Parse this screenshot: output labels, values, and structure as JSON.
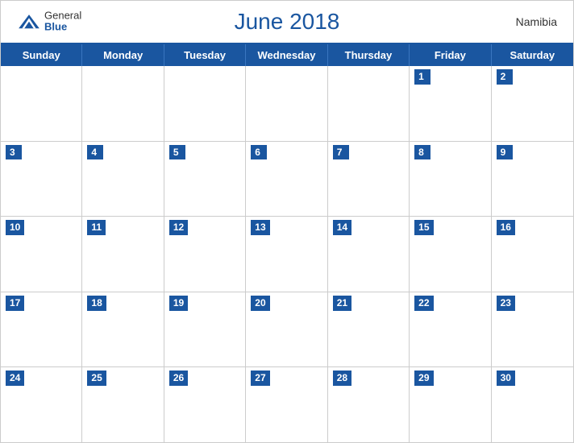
{
  "header": {
    "title": "June 2018",
    "country": "Namibia",
    "logo": {
      "general": "General",
      "blue": "Blue"
    }
  },
  "days_of_week": [
    "Sunday",
    "Monday",
    "Tuesday",
    "Wednesday",
    "Thursday",
    "Friday",
    "Saturday"
  ],
  "weeks": [
    [
      {
        "day": "",
        "empty": true
      },
      {
        "day": "",
        "empty": true
      },
      {
        "day": "",
        "empty": true
      },
      {
        "day": "",
        "empty": true
      },
      {
        "day": "",
        "empty": true
      },
      {
        "day": "1",
        "empty": false
      },
      {
        "day": "2",
        "empty": false
      }
    ],
    [
      {
        "day": "3",
        "empty": false
      },
      {
        "day": "4",
        "empty": false
      },
      {
        "day": "5",
        "empty": false
      },
      {
        "day": "6",
        "empty": false
      },
      {
        "day": "7",
        "empty": false
      },
      {
        "day": "8",
        "empty": false
      },
      {
        "day": "9",
        "empty": false
      }
    ],
    [
      {
        "day": "10",
        "empty": false
      },
      {
        "day": "11",
        "empty": false
      },
      {
        "day": "12",
        "empty": false
      },
      {
        "day": "13",
        "empty": false
      },
      {
        "day": "14",
        "empty": false
      },
      {
        "day": "15",
        "empty": false
      },
      {
        "day": "16",
        "empty": false
      }
    ],
    [
      {
        "day": "17",
        "empty": false
      },
      {
        "day": "18",
        "empty": false
      },
      {
        "day": "19",
        "empty": false
      },
      {
        "day": "20",
        "empty": false
      },
      {
        "day": "21",
        "empty": false
      },
      {
        "day": "22",
        "empty": false
      },
      {
        "day": "23",
        "empty": false
      }
    ],
    [
      {
        "day": "24",
        "empty": false
      },
      {
        "day": "25",
        "empty": false
      },
      {
        "day": "26",
        "empty": false
      },
      {
        "day": "27",
        "empty": false
      },
      {
        "day": "28",
        "empty": false
      },
      {
        "day": "29",
        "empty": false
      },
      {
        "day": "30",
        "empty": false
      }
    ]
  ],
  "colors": {
    "primary": "#1a56a0",
    "header_bg": "#1a56a0",
    "border": "#ccc"
  }
}
